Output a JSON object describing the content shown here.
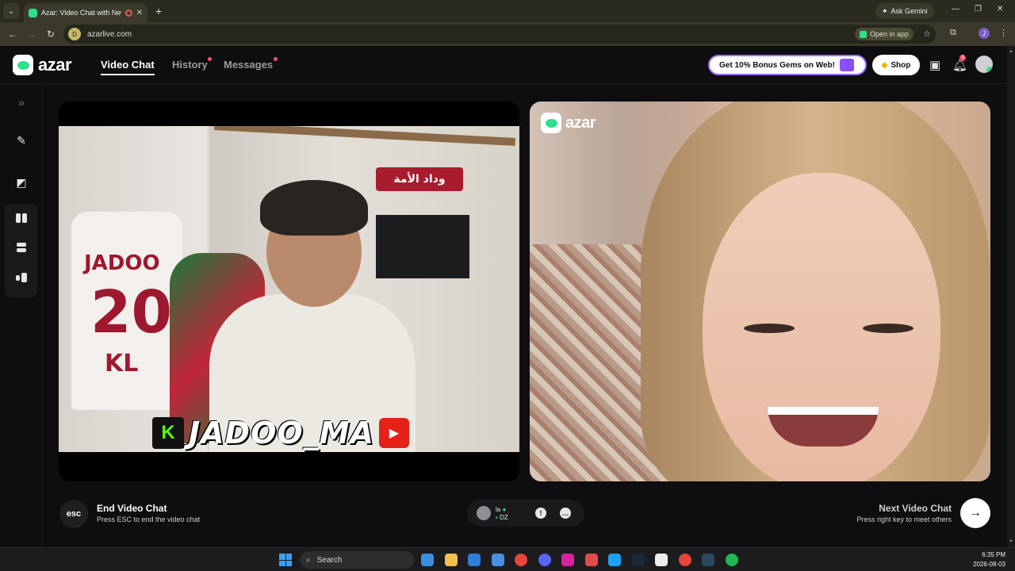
{
  "browser": {
    "tab_title": "Azar: Video Chat with New",
    "url": "azarlive.com",
    "ask_gemini": "Ask Gemini",
    "open_in_app": "Open in app",
    "profile_initial": "J"
  },
  "header": {
    "logo": "azar",
    "nav": [
      {
        "label": "Video Chat",
        "active": true,
        "dot": false
      },
      {
        "label": "History",
        "active": false,
        "dot": true
      },
      {
        "label": "Messages",
        "active": false,
        "dot": true
      }
    ],
    "promo": "Get 10% Bonus Gems on Web!",
    "shop": "Shop",
    "notif_count": "3"
  },
  "videos": {
    "left": {
      "banner": "وداد الأمة",
      "shirt_name": "JADOO",
      "shirt_number": "20",
      "shirt_initials": "KL",
      "overlay_text": "JADOO_MA"
    },
    "right": {
      "watermark": "azar"
    }
  },
  "controls": {
    "esc_label": "esc",
    "end_title": "End Video Chat",
    "end_sub": "Press ESC to end the video chat",
    "peer_line1": "la",
    "peer_line2": "DZ",
    "next_title": "Next Video Chat",
    "next_sub": "Press right key to meet others"
  },
  "taskbar": {
    "search": "Search",
    "time": "6:35 PM",
    "date": "2026-08-03",
    "apps": [
      {
        "name": "photos-icon",
        "color": "#3a8fe0"
      },
      {
        "name": "file-explorer-icon",
        "color": "#f2c14e"
      },
      {
        "name": "mail-icon",
        "color": "#2f7fd6"
      },
      {
        "name": "store-icon",
        "color": "#4a90e2"
      },
      {
        "name": "chrome-icon",
        "color": "#e8453c"
      },
      {
        "name": "discord-icon",
        "color": "#5865f2"
      },
      {
        "name": "instagram-icon",
        "color": "#d6249f"
      },
      {
        "name": "snipping-tool-icon",
        "color": "#e24a4a"
      },
      {
        "name": "app-blue-icon",
        "color": "#1da1f2"
      },
      {
        "name": "steam-icon",
        "color": "#1b2838"
      },
      {
        "name": "network-icon",
        "color": "#eeeeee"
      },
      {
        "name": "chrome-active-icon",
        "color": "#e8453c"
      },
      {
        "name": "steam-2-icon",
        "color": "#2a475e"
      },
      {
        "name": "spotify-icon",
        "color": "#1db954"
      }
    ]
  }
}
